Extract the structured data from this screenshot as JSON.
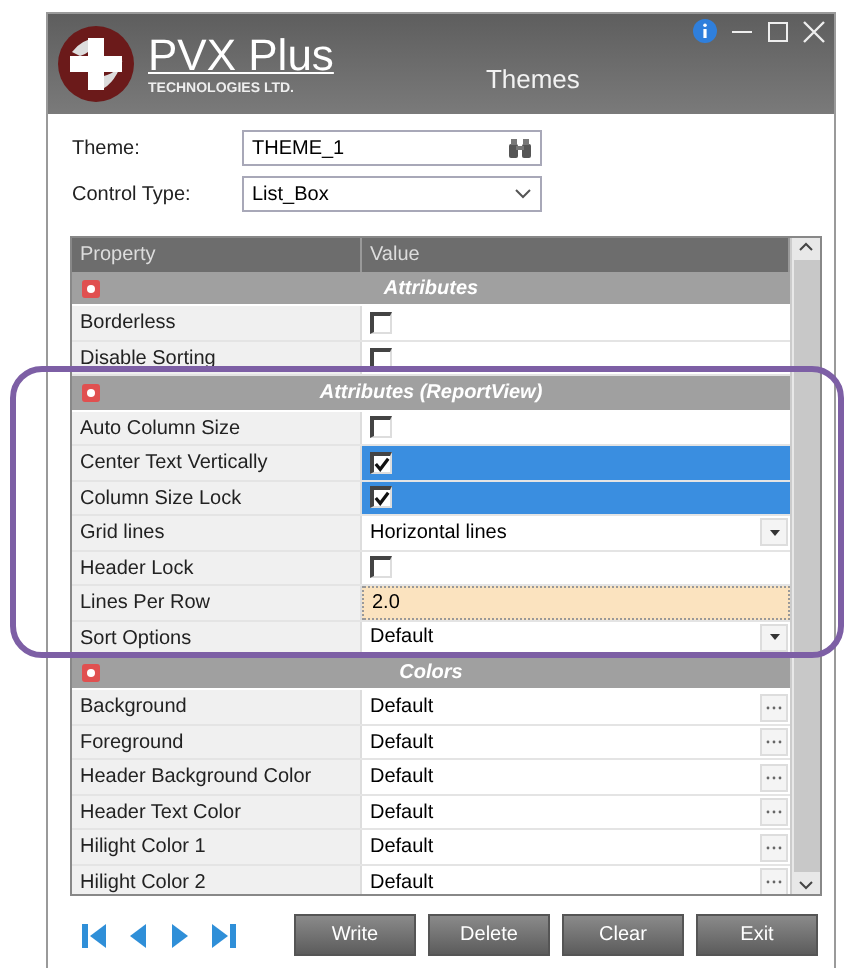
{
  "window": {
    "title": "Themes",
    "logo": {
      "name": "PVX Plus",
      "tagline": "TECHNOLOGIES LTD."
    }
  },
  "form": [
    {
      "label": "Theme:",
      "value": "THEME_1",
      "kind": "lookup"
    },
    {
      "label": "Control Type:",
      "value": "List_Box",
      "kind": "dropdown"
    }
  ],
  "grid": {
    "columns": [
      "Property",
      "Value"
    ],
    "groups": [
      {
        "title": "Attributes",
        "rows": [
          {
            "property": "Borderless",
            "kind": "checkbox",
            "checked": false,
            "selected": false
          },
          {
            "property": "Disable Sorting",
            "kind": "checkbox",
            "checked": false,
            "selected": false
          }
        ]
      },
      {
        "title": "Attributes (ReportView)",
        "rows": [
          {
            "property": "Auto Column Size",
            "kind": "checkbox",
            "checked": false,
            "selected": false
          },
          {
            "property": "Center Text Vertically",
            "kind": "checkbox",
            "checked": true,
            "selected": true
          },
          {
            "property": "Column Size Lock",
            "kind": "checkbox",
            "checked": true,
            "selected": true
          },
          {
            "property": "Grid lines",
            "kind": "dropdown",
            "value": "Horizontal lines",
            "selected": false
          },
          {
            "property": "Header Lock",
            "kind": "checkbox",
            "checked": false,
            "selected": false
          },
          {
            "property": "Lines Per Row",
            "kind": "text",
            "value": "2.0",
            "focused": true,
            "selected": false
          },
          {
            "property": "Sort Options",
            "kind": "dropdown",
            "value": "Default",
            "selected": false
          }
        ]
      },
      {
        "title": "Colors",
        "rows": [
          {
            "property": "Background",
            "kind": "picker",
            "value": "Default",
            "selected": false
          },
          {
            "property": "Foreground",
            "kind": "picker",
            "value": "Default",
            "selected": false
          },
          {
            "property": "Header Background Color",
            "kind": "picker",
            "value": "Default",
            "selected": false
          },
          {
            "property": "Header Text Color",
            "kind": "picker",
            "value": "Default",
            "selected": false
          },
          {
            "property": "Hilight Color 1",
            "kind": "picker",
            "value": "Default",
            "selected": false
          },
          {
            "property": "Hilight Color 2",
            "kind": "picker",
            "value": "Default",
            "selected": false
          }
        ]
      }
    ]
  },
  "buttons": [
    "Write",
    "Delete",
    "Clear",
    "Exit"
  ]
}
